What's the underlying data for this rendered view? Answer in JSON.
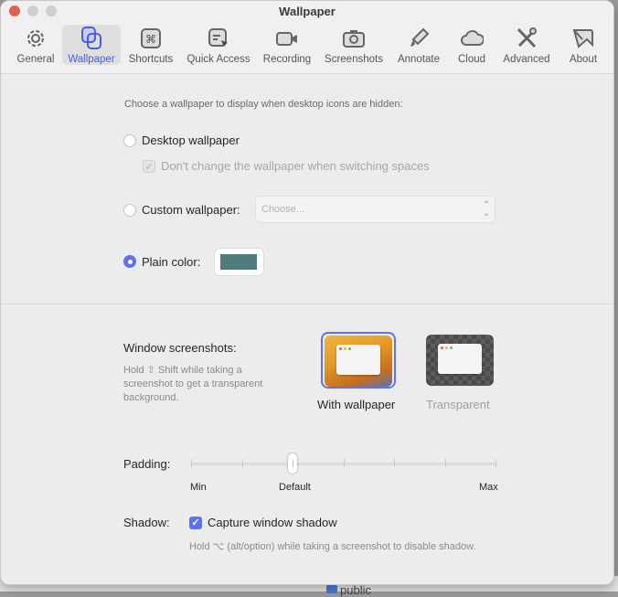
{
  "window": {
    "title": "Wallpaper"
  },
  "toolbar": {
    "items": [
      {
        "label": "General",
        "icon": "gear-icon"
      },
      {
        "label": "Wallpaper",
        "icon": "wallpaper-icon",
        "selected": true
      },
      {
        "label": "Shortcuts",
        "icon": "command-icon"
      },
      {
        "label": "Quick Access",
        "icon": "quick-access-icon"
      },
      {
        "label": "Recording",
        "icon": "video-camera-icon"
      },
      {
        "label": "Screenshots",
        "icon": "camera-icon"
      },
      {
        "label": "Annotate",
        "icon": "highlighter-icon"
      },
      {
        "label": "Cloud",
        "icon": "cloud-icon"
      },
      {
        "label": "Advanced",
        "icon": "tools-icon"
      },
      {
        "label": "About",
        "icon": "about-icon"
      }
    ]
  },
  "wallpaper": {
    "intro": "Choose a wallpaper to display when desktop icons are hidden:",
    "desktop_label": "Desktop wallpaper",
    "dont_change_label": "Don't change the wallpaper when switching spaces",
    "custom_label": "Custom wallpaper:",
    "custom_placeholder": "Choose...",
    "plain_label": "Plain color:",
    "plain_color": "#517c7d",
    "selected": "plain"
  },
  "screenshots": {
    "label": "Window screenshots:",
    "hint": "Hold ⇧ Shift while taking a screenshot to get a transparent background.",
    "with_wallpaper": "With wallpaper",
    "transparent": "Transparent",
    "selected": "with_wallpaper"
  },
  "padding": {
    "label": "Padding:",
    "min": "Min",
    "default": "Default",
    "max": "Max",
    "value_fraction": 0.333,
    "ticks": 7
  },
  "shadow": {
    "label": "Shadow:",
    "checkbox": "Capture window shadow",
    "checked": true,
    "hint": "Hold ⌥ (alt/option) while taking a screenshot to disable shadow."
  },
  "background": {
    "folder": "public"
  },
  "colors": {
    "accent": "#5b73f0"
  }
}
